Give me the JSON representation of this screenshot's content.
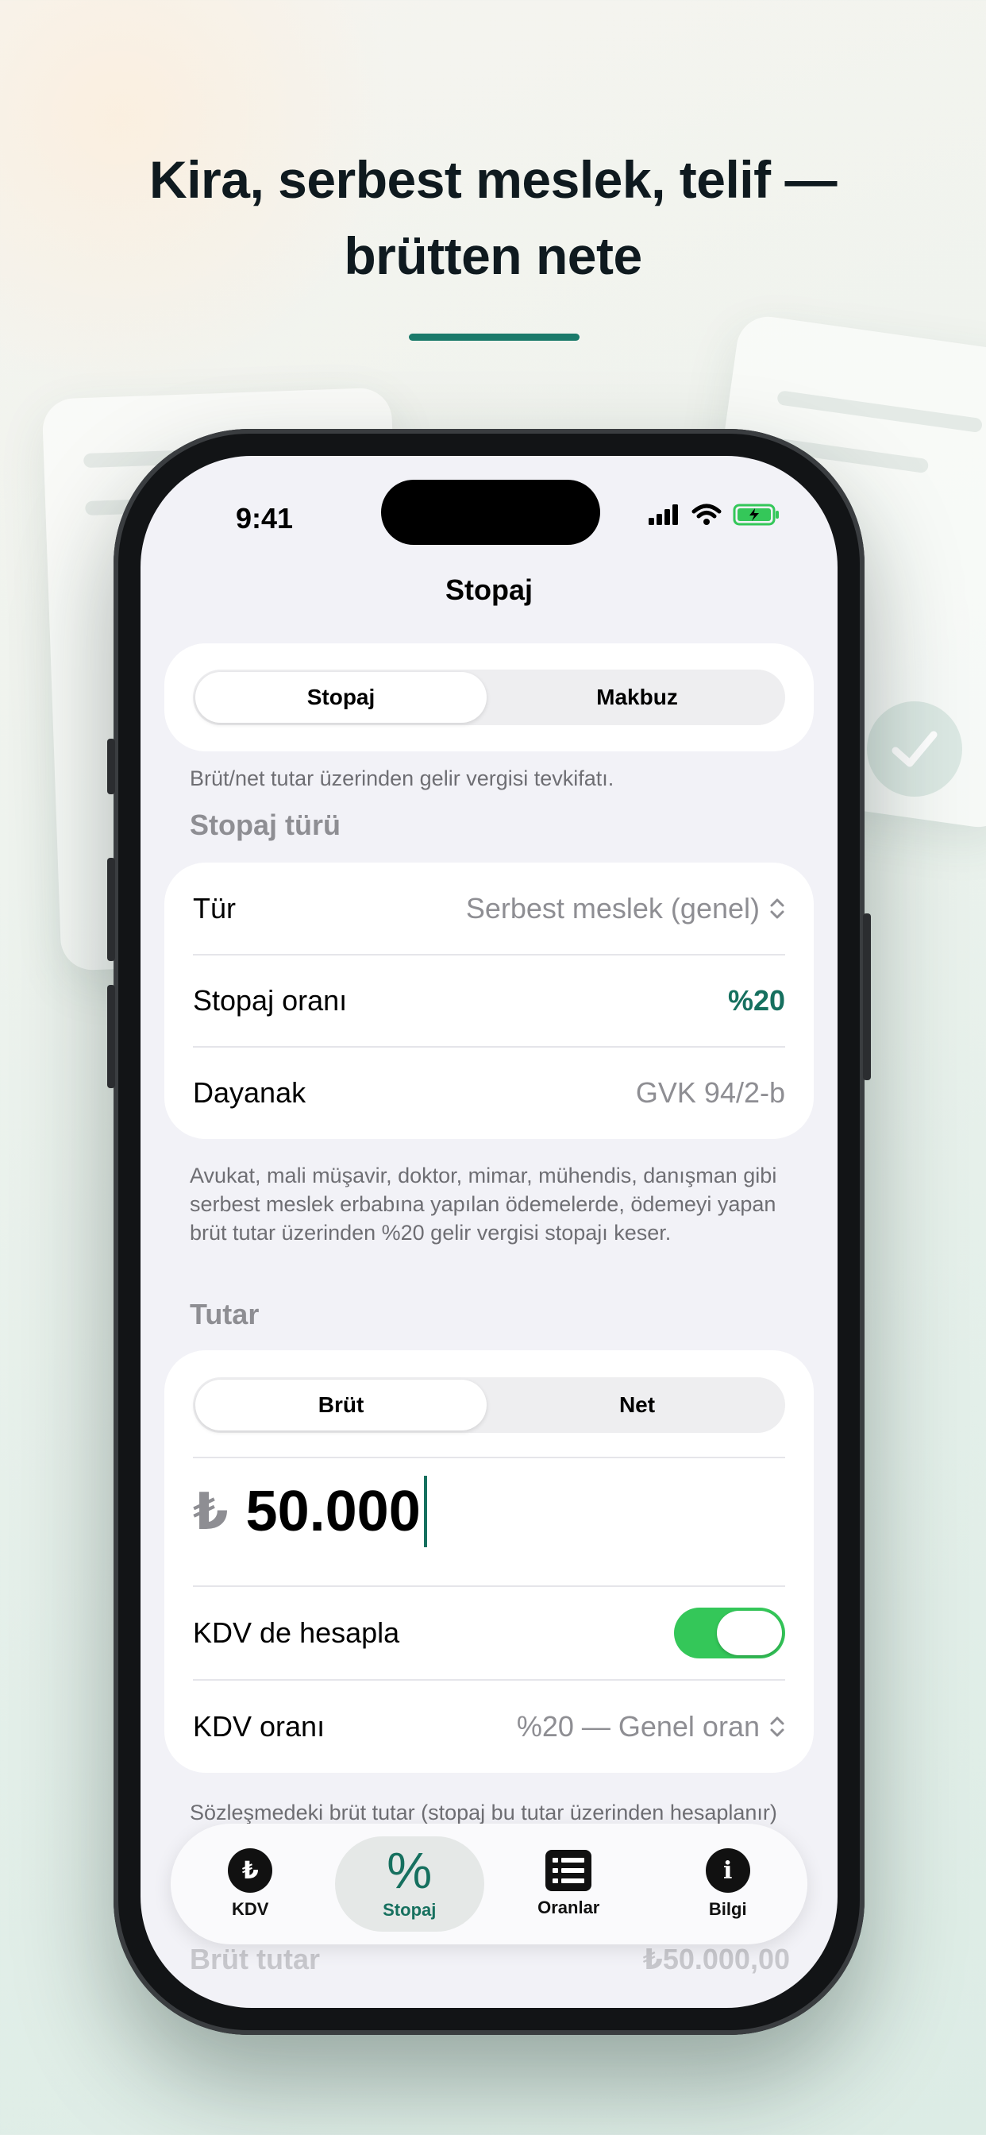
{
  "headline": {
    "line1": "Kira, serbest meslek, telif —",
    "line2": "brütten nete"
  },
  "status": {
    "time": "9:41"
  },
  "nav": {
    "title": "Stopaj"
  },
  "mode_segment": {
    "options": [
      "Stopaj",
      "Makbuz"
    ],
    "selected": "Stopaj"
  },
  "mode_caption": "Brüt/net tutar üzerinden gelir vergisi tevkifatı.",
  "type_section": {
    "header": "Stopaj türü",
    "rows": {
      "type": {
        "label": "Tür",
        "value": "Serbest meslek (genel)"
      },
      "rate": {
        "label": "Stopaj oranı",
        "value": "%20"
      },
      "basis": {
        "label": "Dayanak",
        "value": "GVK 94/2-b"
      }
    },
    "description": "Avukat, mali müşavir, doktor, mimar, mühendis, danışman gibi serbest meslek erbabına yapılan ödemelerde, ödemeyi yapan brüt tutar üzerinden %20 gelir vergisi stopajı keser."
  },
  "amount_section": {
    "header": "Tutar",
    "gross_net_segment": {
      "options": [
        "Brüt",
        "Net"
      ],
      "selected": "Brüt"
    },
    "currency_symbol": "₺",
    "amount_value": "50.000",
    "vat_toggle": {
      "label": "KDV de hesapla",
      "on": true
    },
    "vat_rate": {
      "label": "KDV oranı",
      "value": "%20 — Genel oran"
    },
    "footnote": "Sözleşmedeki brüt tutar (stopaj bu tutar üzerinden hesaplanır)"
  },
  "result_peek": {
    "label": "Brüt tutar",
    "value": "₺50.000,00"
  },
  "tabbar": {
    "items": [
      {
        "label": "KDV",
        "icon": "lira-circle-icon",
        "glyph": "₺"
      },
      {
        "label": "Stopaj",
        "icon": "percent-icon",
        "glyph": "%"
      },
      {
        "label": "Oranlar",
        "icon": "list-icon"
      },
      {
        "label": "Bilgi",
        "icon": "info-circle-icon",
        "glyph": "i"
      }
    ],
    "active": "Stopaj"
  },
  "colors": {
    "accent": "#16705f",
    "toggle_on": "#34c759",
    "screen_bg": "#f2f2f7"
  }
}
